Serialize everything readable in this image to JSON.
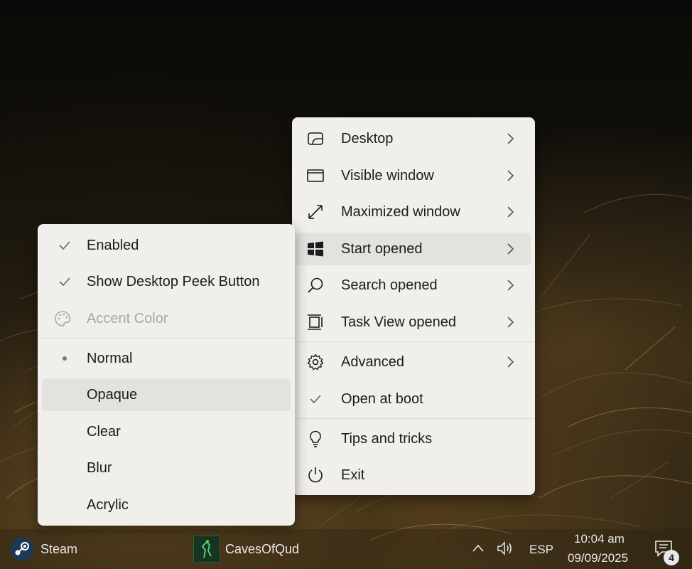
{
  "main_menu": {
    "items": [
      {
        "label": "Desktop",
        "icon": "desktop-icon"
      },
      {
        "label": "Visible window",
        "icon": "window-icon"
      },
      {
        "label": "Maximized window",
        "icon": "maximize-icon"
      },
      {
        "label": "Start opened",
        "icon": "windows-logo-icon"
      },
      {
        "label": "Search opened",
        "icon": "search-icon"
      },
      {
        "label": "Task View opened",
        "icon": "task-view-icon"
      },
      {
        "label": "Advanced",
        "icon": "gear-icon"
      },
      {
        "label": "Open at boot",
        "icon": "checkmark-icon"
      },
      {
        "label": "Tips and tricks",
        "icon": "lightbulb-icon"
      },
      {
        "label": "Exit",
        "icon": "power-icon"
      }
    ]
  },
  "sub_menu": {
    "items": [
      {
        "label": "Enabled",
        "state": "checked"
      },
      {
        "label": "Show Desktop Peek Button",
        "state": "checked"
      },
      {
        "label": "Accent Color",
        "state": "disabled"
      },
      {
        "label": "Normal",
        "state": "selected"
      },
      {
        "label": "Opaque",
        "state": "hover"
      },
      {
        "label": "Clear",
        "state": ""
      },
      {
        "label": "Blur",
        "state": ""
      },
      {
        "label": "Acrylic",
        "state": ""
      }
    ]
  },
  "taskbar": {
    "steam_label": "Steam",
    "app_label": "CavesOfQud",
    "language": "ESP",
    "time": "10:04 am",
    "date": "09/09/2025",
    "notification_count": "4"
  },
  "colors": {
    "menu_bg": "#f1efec",
    "hover_bg": "#e4e2df",
    "text": "#1c1c1c",
    "disabled_text": "#a9a7a4"
  }
}
